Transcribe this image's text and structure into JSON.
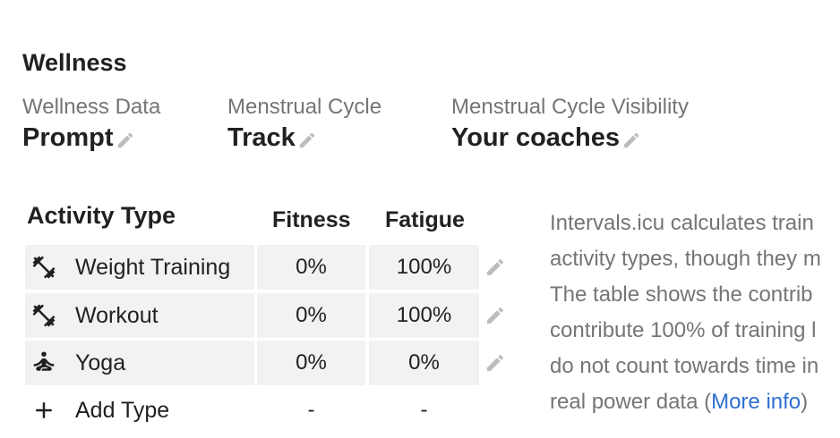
{
  "section_title": "Wellness",
  "fields": [
    {
      "label": "Wellness Data",
      "value": "Prompt"
    },
    {
      "label": "Menstrual Cycle",
      "value": "Track"
    },
    {
      "label": "Menstrual Cycle Visibility",
      "value": "Your coaches"
    }
  ],
  "table": {
    "headers": {
      "type": "Activity Type",
      "fitness": "Fitness",
      "fatigue": "Fatigue"
    },
    "rows": [
      {
        "icon": "weight-training-icon",
        "type": "Weight Training",
        "fitness": "0%",
        "fatigue": "100%"
      },
      {
        "icon": "weight-training-icon",
        "type": "Workout",
        "fitness": "0%",
        "fatigue": "100%"
      },
      {
        "icon": "yoga-icon",
        "type": "Yoga",
        "fitness": "0%",
        "fatigue": "0%"
      }
    ],
    "add_row": {
      "icon": "plus-icon",
      "label": "Add Type",
      "fitness": "-",
      "fatigue": "-"
    }
  },
  "description": {
    "lines": [
      "Intervals.icu calculates train",
      "activity types, though they m",
      "The table shows the contrib",
      "contribute 100% of training l",
      "do not count towards time in"
    ],
    "last_line_prefix": "real power data (",
    "link_text": "More info",
    "last_line_suffix": ")"
  },
  "colors": {
    "label_gray": "#757575",
    "cell_bg": "#f2f2f2",
    "link": "#2f6fd1",
    "icon_gray": "#bdbdbd"
  }
}
